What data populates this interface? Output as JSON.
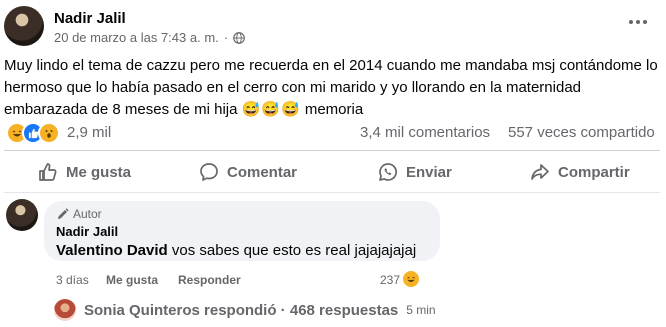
{
  "post": {
    "author": "Nadir Jalil",
    "timestamp": "20 de marzo a las 7:43 a. m.",
    "meta_separator": "·",
    "text_main": "Muy lindo el tema de cazzu pero me recuerda en el 2014 cuando me mandaba msj contándome lo hermoso que lo había pasado en el cerro con mi marido y yo llorando en la maternidad embarazada de 8 meses de mi hija",
    "text_emojis": "😅😅😅",
    "text_end": "memoria"
  },
  "stats": {
    "reaction_count": "2,9 mil",
    "comment_count": "3,4 mil comentarios",
    "share_count": "557 veces compartido"
  },
  "actions": {
    "like": "Me gusta",
    "comment": "Comentar",
    "send": "Enviar",
    "share": "Compartir"
  },
  "comment": {
    "badge": "Autor",
    "author": "Nadir Jalil",
    "tagged": "Valentino David",
    "text": "vos sabes que esto es real jajajajajaj",
    "time": "3 días",
    "like": "Me gusta",
    "reply": "Responder",
    "reaction_count": "237"
  },
  "replies": {
    "text": "Sonia Quinteros respondió · 468 respuestas",
    "time": "5 min"
  },
  "colors": {
    "text_primary": "#050505",
    "text_secondary": "#65676b",
    "bubble": "#f0f2f5",
    "like_blue": "#1877f2",
    "reaction_yellow": "#f7b125"
  },
  "icons": [
    "globe-icon",
    "more-icon",
    "haha-reaction-icon",
    "like-reaction-icon",
    "wow-reaction-icon",
    "thumb-up-icon",
    "comment-icon",
    "whatsapp-icon",
    "share-icon",
    "pencil-icon"
  ]
}
